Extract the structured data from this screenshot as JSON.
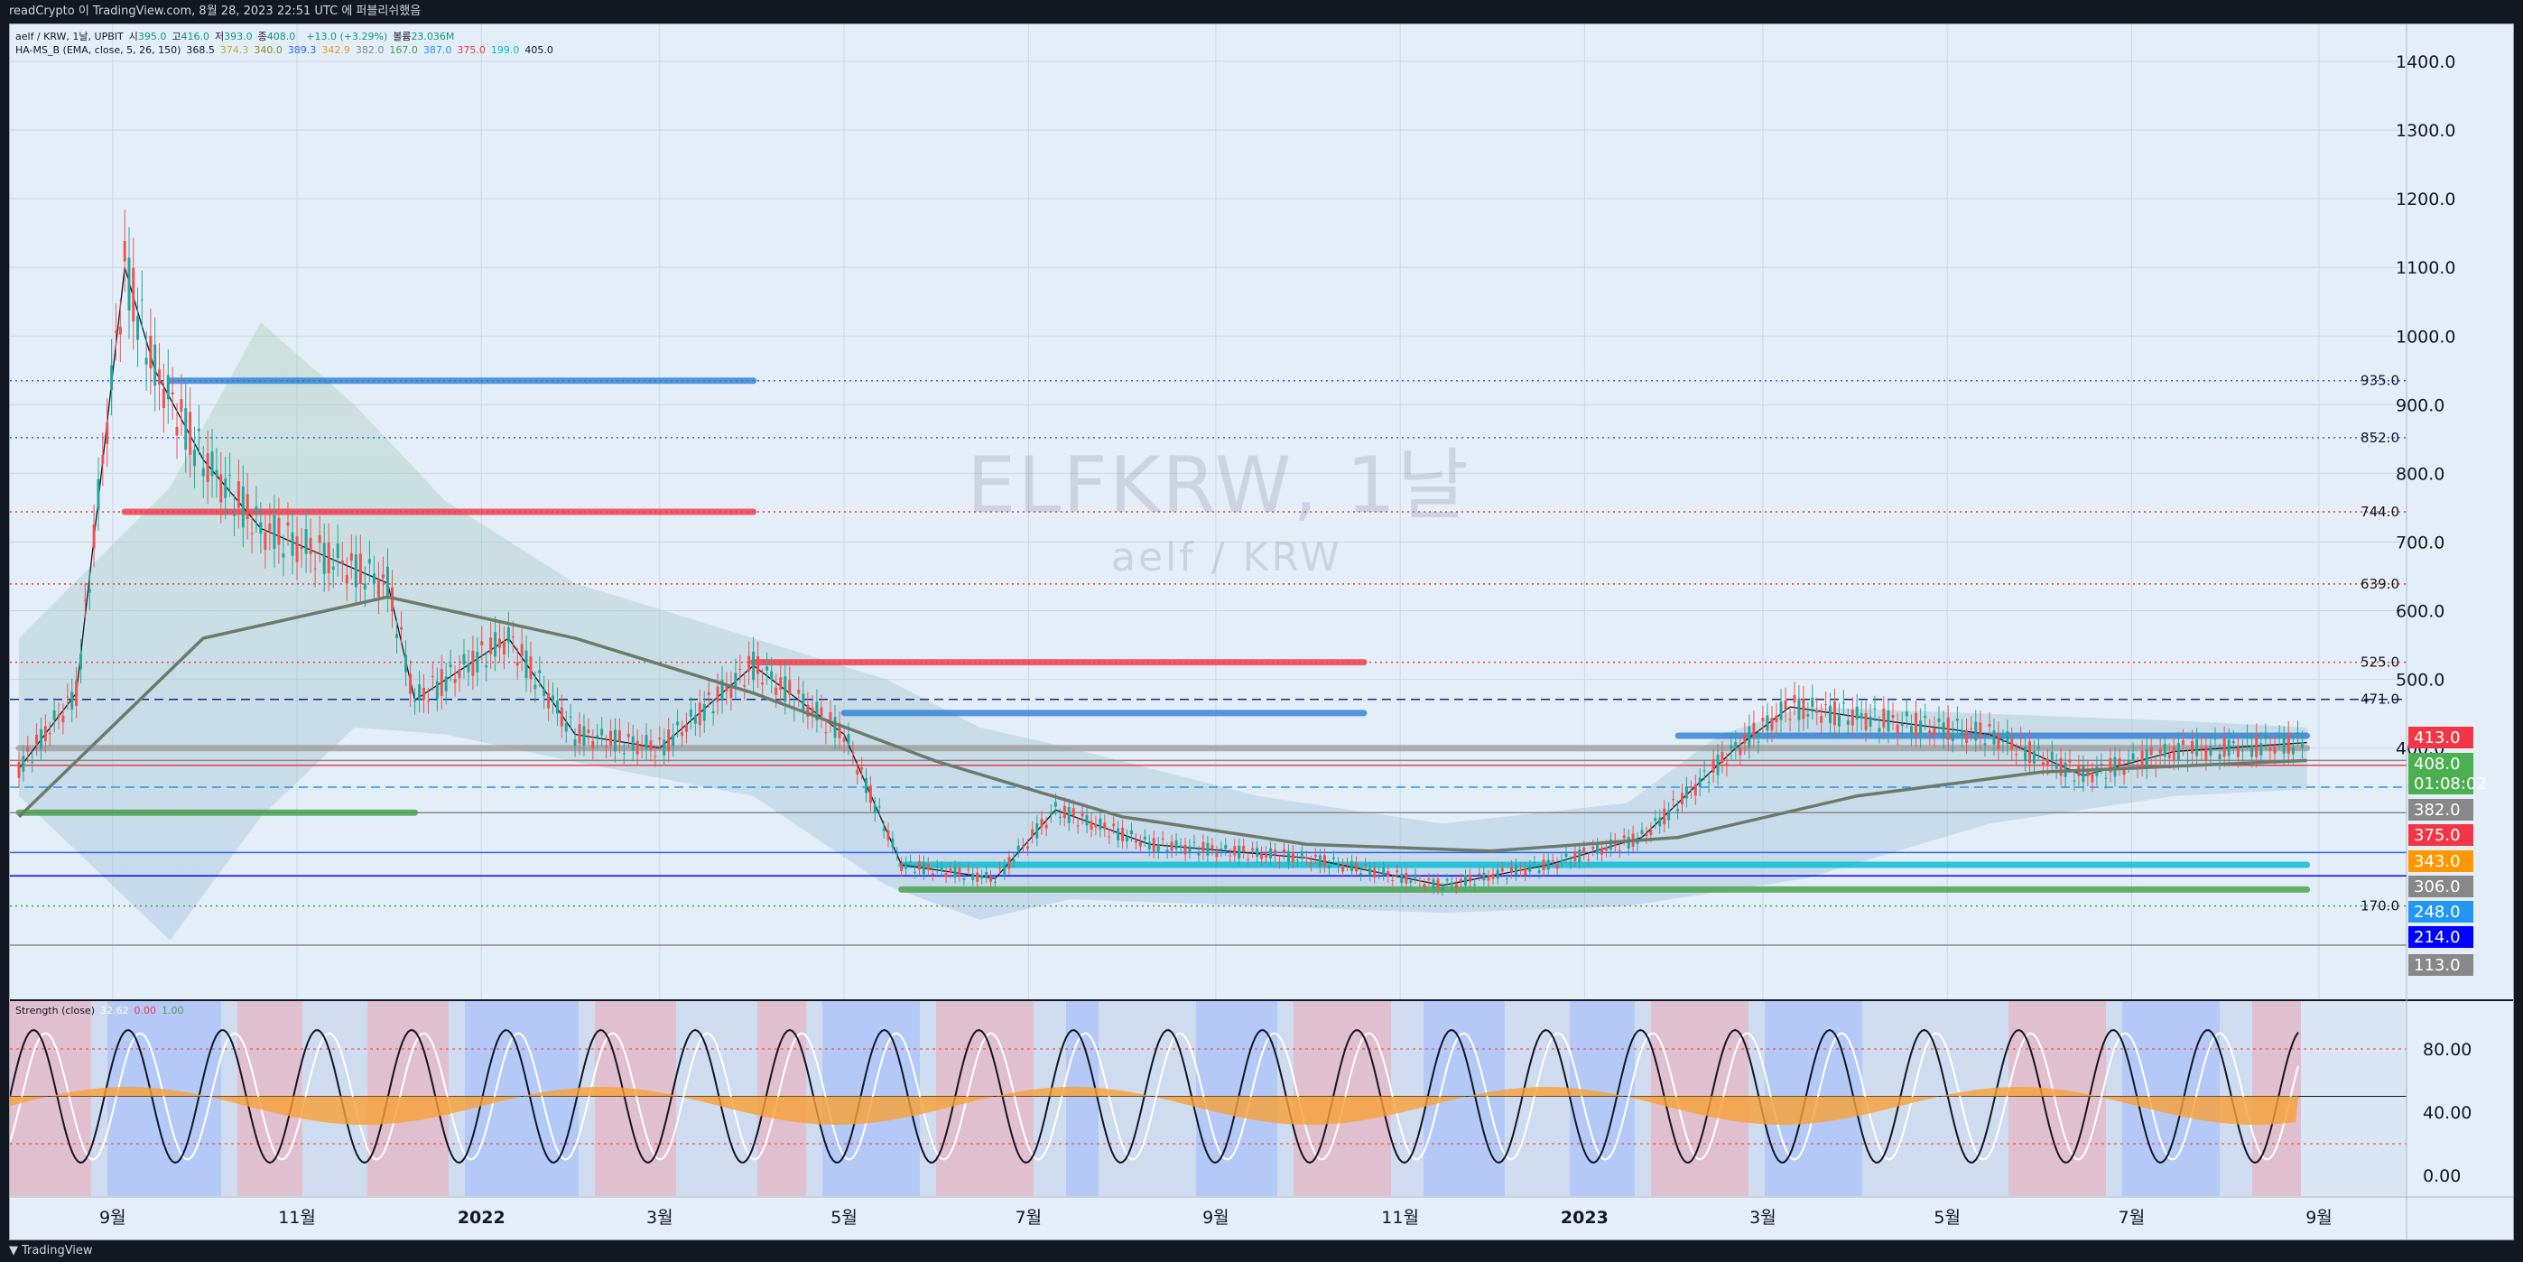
{
  "header": {
    "text": "readCrypto 이 TradingView.com, 8월 28, 2023 22:51 UTC 에 퍼블리쉬했음"
  },
  "footer": {
    "logo_text": "TradingView"
  },
  "legend": {
    "symbol": "aelf / KRW, 1날, UPBIT",
    "ohlc": [
      {
        "label": "시",
        "value": "395.0"
      },
      {
        "label": "고",
        "value": "416.0"
      },
      {
        "label": "저",
        "value": "393.0"
      },
      {
        "label": "종",
        "value": "408.0"
      }
    ],
    "change": "+13.0 (+3.29%)",
    "volume_label": "볼륨",
    "volume_value": "23.036M",
    "indicator_name": "HA-MS_B (EMA, close, 5, 26, 150)",
    "indicator_values": [
      {
        "value": "368.5",
        "color": "#131722"
      },
      {
        "value": "374.3",
        "color": "#b5b52b"
      },
      {
        "value": "340.0",
        "color": "#8a8a1f"
      },
      {
        "value": "389.3",
        "color": "#2962ff"
      },
      {
        "value": "342.9",
        "color": "#f7931a"
      },
      {
        "value": "382.0",
        "color": "#888888"
      },
      {
        "value": "167.0",
        "color": "#43a047"
      },
      {
        "value": "387.0",
        "color": "#2196f3"
      },
      {
        "value": "375.0",
        "color": "#f23645"
      },
      {
        "value": "199.0",
        "color": "#00bcd4"
      },
      {
        "value": "405.0",
        "color": "#131722"
      }
    ],
    "strength_name": "Strength (close)",
    "strength_values": [
      {
        "value": "32.62",
        "color": "#ffffff"
      },
      {
        "value": "0.00",
        "color": "#f23645"
      },
      {
        "value": "1.00",
        "color": "#43a047"
      }
    ]
  },
  "watermark": {
    "main": "ELFKRW, 1날",
    "sub": "aelf / KRW"
  },
  "price_axis": {
    "ticks": [
      "1400.0",
      "1300.0",
      "1200.0",
      "1100.0",
      "1000.0",
      "900.0",
      "800.0",
      "700.0",
      "600.0",
      "500.0",
      "400.0"
    ]
  },
  "strength_axis": {
    "ticks": [
      "80.00",
      "40.00",
      "0.00"
    ]
  },
  "time_axis": {
    "ticks": [
      "9월",
      "11월",
      "2022",
      "3월",
      "5월",
      "7월",
      "9월",
      "11월",
      "2023",
      "3월",
      "5월",
      "7월",
      "9월"
    ]
  },
  "level_labels": [
    {
      "value": "935.0",
      "price": 935,
      "color": "#2962ff"
    },
    {
      "value": "852.0",
      "price": 852,
      "color": "#2962ff"
    },
    {
      "value": "744.0",
      "price": 744,
      "color": "#f23645"
    },
    {
      "value": "639.0",
      "price": 639,
      "color": "#f23645"
    },
    {
      "value": "525.0",
      "price": 525,
      "color": "#f23645"
    },
    {
      "value": "471.0",
      "price": 471,
      "color": "#1a237e"
    },
    {
      "value": "170.0",
      "price": 170,
      "color": "#43a047"
    }
  ],
  "price_tags": [
    {
      "value": "413.0",
      "bg": "#f23645"
    },
    {
      "value": "408.0",
      "bg": "#4caf50"
    },
    {
      "value": "01:08:02",
      "bg": "#4caf50"
    },
    {
      "value": "382.0",
      "bg": "#888888"
    },
    {
      "value": "375.0",
      "bg": "#f23645"
    },
    {
      "value": "343.0",
      "bg": "#ff9800"
    },
    {
      "value": "306.0",
      "bg": "#888888"
    },
    {
      "value": "248.0",
      "bg": "#2196f3"
    },
    {
      "value": "214.0",
      "bg": "#0000ff"
    },
    {
      "value": "113.0",
      "bg": "#888888"
    }
  ],
  "chart_data": {
    "type": "candlestick",
    "title": "",
    "xlabel": "",
    "ylabel": "",
    "ylim": [
      100,
      1450
    ],
    "x_ticks": [
      "9월",
      "11월",
      "2022",
      "3월",
      "5월",
      "7월",
      "9월",
      "11월",
      "2023",
      "3월",
      "5월",
      "7월",
      "9월"
    ],
    "approx_close_path": [
      {
        "x": "2021-08",
        "y": 370
      },
      {
        "x": "2021-08-20",
        "y": 480
      },
      {
        "x": "2021-09-05",
        "y": 1100
      },
      {
        "x": "2021-09-15",
        "y": 950
      },
      {
        "x": "2021-10-01",
        "y": 820
      },
      {
        "x": "2021-10-20",
        "y": 720
      },
      {
        "x": "2021-11-10",
        "y": 680
      },
      {
        "x": "2021-12-01",
        "y": 640
      },
      {
        "x": "2021-12-10",
        "y": 470
      },
      {
        "x": "2022-01-10",
        "y": 560
      },
      {
        "x": "2022-02-01",
        "y": 420
      },
      {
        "x": "2022-03-01",
        "y": 400
      },
      {
        "x": "2022-04-01",
        "y": 520
      },
      {
        "x": "2022-05-01",
        "y": 420
      },
      {
        "x": "2022-05-20",
        "y": 230
      },
      {
        "x": "2022-06-20",
        "y": 210
      },
      {
        "x": "2022-07-10",
        "y": 310
      },
      {
        "x": "2022-08-10",
        "y": 260
      },
      {
        "x": "2022-10-01",
        "y": 240
      },
      {
        "x": "2022-11-15",
        "y": 200
      },
      {
        "x": "2022-12-20",
        "y": 230
      },
      {
        "x": "2023-01-20",
        "y": 270
      },
      {
        "x": "2023-02-20",
        "y": 400
      },
      {
        "x": "2023-03-10",
        "y": 460
      },
      {
        "x": "2023-04-10",
        "y": 440
      },
      {
        "x": "2023-05-15",
        "y": 420
      },
      {
        "x": "2023-06-15",
        "y": 360
      },
      {
        "x": "2023-07-15",
        "y": 395
      },
      {
        "x": "2023-08-28",
        "y": 408
      }
    ]
  }
}
